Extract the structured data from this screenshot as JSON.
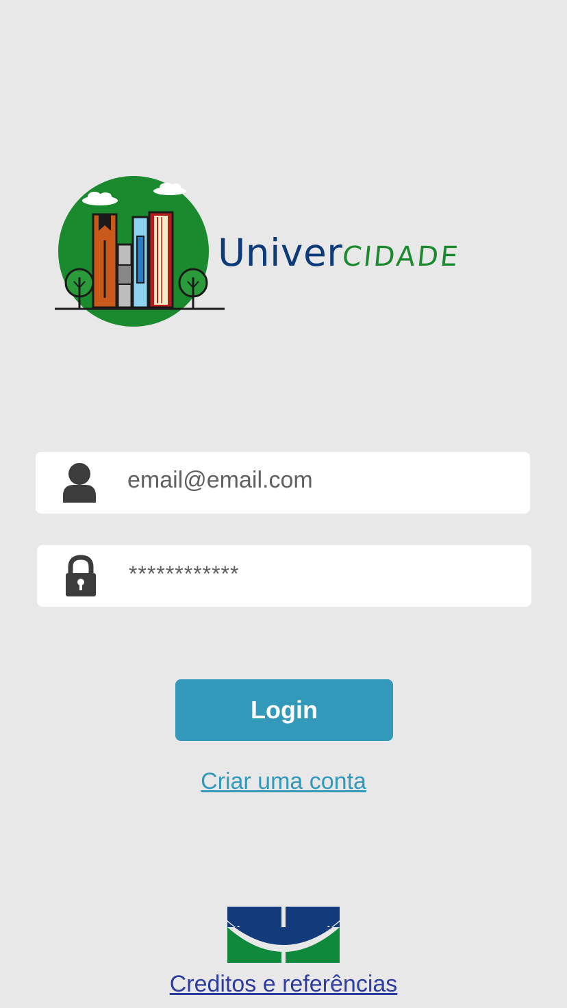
{
  "logo": {
    "word_part1": "Univer",
    "word_part2": "CIDADE",
    "colors": {
      "primary": "#0d3a78",
      "secondary": "#1b8a2e",
      "circle": "#1b8a2e"
    }
  },
  "login_form": {
    "email_value": "email@email.com",
    "password_value": "************",
    "email_icon": "user-icon",
    "password_icon": "lock-icon",
    "login_label": "Login",
    "create_account_label": "Criar uma conta"
  },
  "footer": {
    "institution_logo": "unb-logo",
    "credits_label": "Creditos e referências"
  },
  "colors": {
    "background": "#e8e8e8",
    "accent": "#3399bb",
    "link_dark": "#2e3c9e"
  }
}
